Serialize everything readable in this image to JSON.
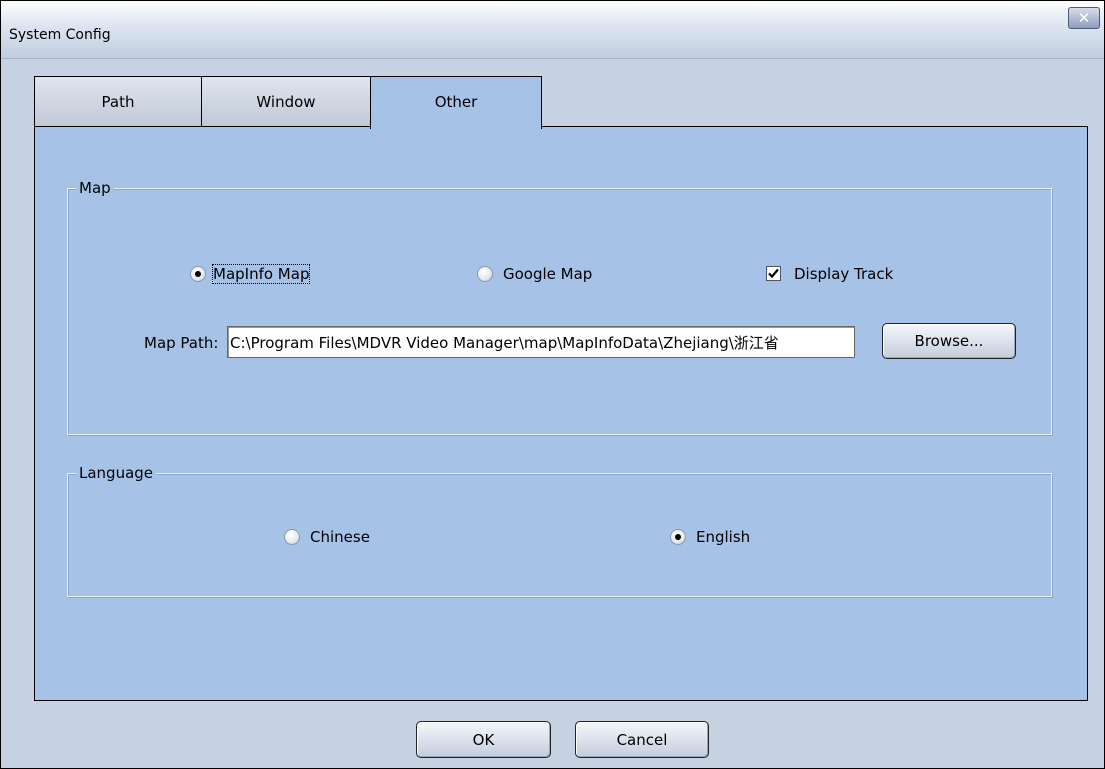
{
  "window": {
    "title": "System Config",
    "close_glyph": "✕"
  },
  "tabs": [
    {
      "label": "Path",
      "active": false
    },
    {
      "label": "Window",
      "active": false
    },
    {
      "label": "Other",
      "active": true
    }
  ],
  "map_group": {
    "label": "Map",
    "options": [
      {
        "label": "MapInfo Map",
        "selected": true
      },
      {
        "label": "Google Map",
        "selected": false
      }
    ],
    "display_track": {
      "label": "Display Track",
      "checked": true
    },
    "map_path": {
      "label": "Map Path:",
      "value": "C:\\Program Files\\MDVR Video Manager\\map\\MapInfoData\\Zhejiang\\浙江省"
    },
    "browse_label": "Browse..."
  },
  "language_group": {
    "label": "Language",
    "options": [
      {
        "label": "Chinese",
        "selected": false
      },
      {
        "label": "English",
        "selected": true
      }
    ]
  },
  "footer": {
    "ok_label": "OK",
    "cancel_label": "Cancel"
  },
  "colors": {
    "panel": "#a6c3e7",
    "window_bg": "#c6d1e2",
    "tab_inactive": "#c9d0de"
  }
}
